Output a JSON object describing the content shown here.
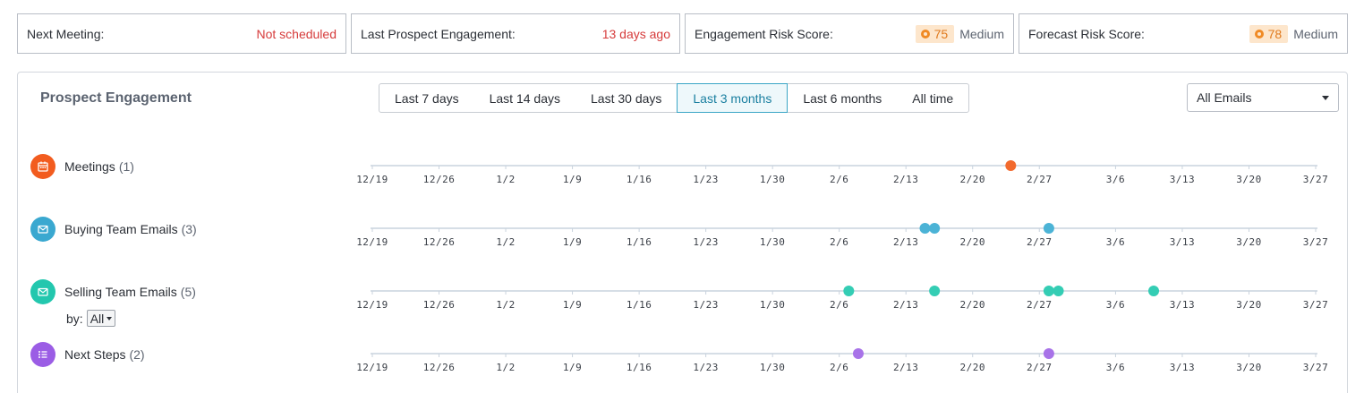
{
  "summary": {
    "next_meeting": {
      "label": "Next Meeting:",
      "value": "Not scheduled"
    },
    "last_engagement": {
      "label": "Last Prospect Engagement:",
      "value": "13 days ago"
    },
    "engagement_risk": {
      "label": "Engagement Risk Score:",
      "score": "75",
      "level": "Medium"
    },
    "forecast_risk": {
      "label": "Forecast Risk Score:",
      "score": "78",
      "level": "Medium"
    }
  },
  "panel": {
    "title": "Prospect Engagement",
    "ranges": [
      "Last 7 days",
      "Last 14 days",
      "Last 30 days",
      "Last 3 months",
      "Last 6 months",
      "All time"
    ],
    "active_range": "Last 3 months",
    "filter": {
      "selected": "All Emails"
    },
    "by_label": "by:",
    "by_value": "All"
  },
  "timeline": {
    "ticks": [
      "12/19",
      "12/26",
      "1/2",
      "1/9",
      "1/16",
      "1/23",
      "1/30",
      "2/6",
      "2/13",
      "2/20",
      "2/27",
      "3/6",
      "3/13",
      "3/20",
      "3/27"
    ],
    "rows": [
      {
        "name": "Meetings",
        "count": "(1)",
        "icon": "calendar-icon",
        "color": "#f25c1f",
        "dot_color": "#f26a2e",
        "events": [
          "2/24"
        ]
      },
      {
        "name": "Buying Team Emails",
        "count": "(3)",
        "icon": "envelope-icon",
        "color": "#3aa8d0",
        "dot_color": "#4bb3d6",
        "events": [
          "2/15",
          "2/16",
          "2/28"
        ]
      },
      {
        "name": "Selling Team Emails",
        "count": "(5)",
        "icon": "envelope-icon",
        "color": "#23c7ae",
        "dot_color": "#34cdb4",
        "events": [
          "2/7",
          "2/16",
          "2/28",
          "2/29",
          "3/10"
        ]
      },
      {
        "name": "Next Steps",
        "count": "(2)",
        "icon": "list-icon",
        "color": "#9b5de5",
        "dot_color": "#a873e8",
        "events": [
          "2/8",
          "2/28"
        ]
      }
    ]
  }
}
